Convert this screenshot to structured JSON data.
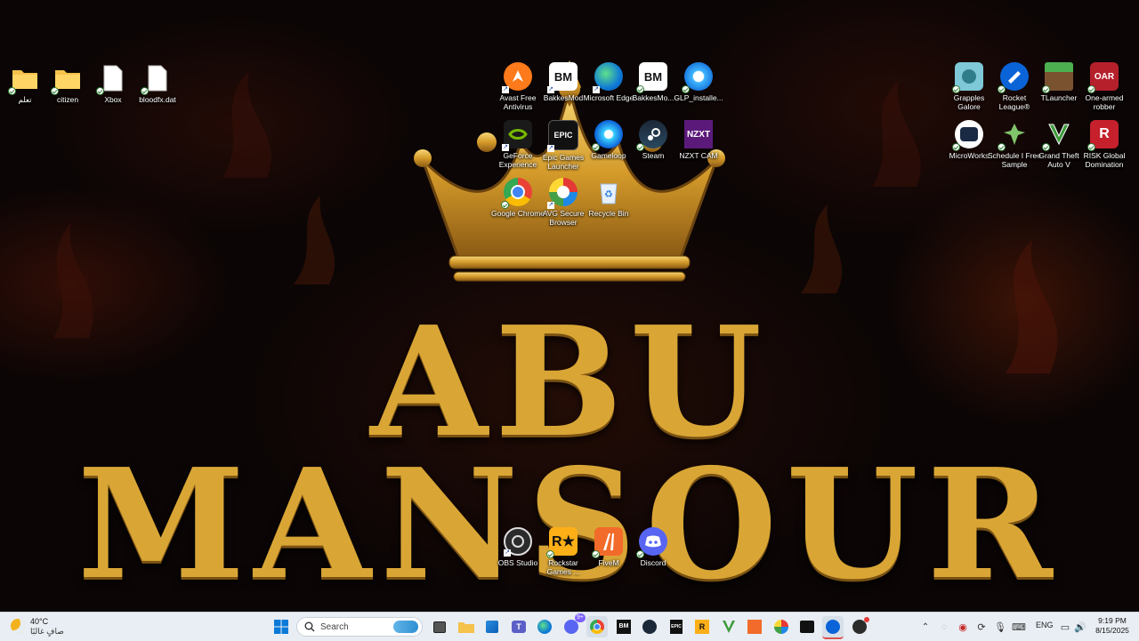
{
  "wallpaper": {
    "line1": "ABU",
    "line2": "MANSOUR"
  },
  "desktop": {
    "left": [
      {
        "label": "تعلم",
        "icon": "folder-icon"
      },
      {
        "label": "citizen",
        "icon": "folder-icon"
      },
      {
        "label": "Xbox",
        "icon": "file-icon"
      },
      {
        "label": "bloodfx.dat",
        "icon": "file-icon"
      }
    ],
    "center": [
      {
        "label": "Avast Free Antivirus",
        "icon": "avast-icon"
      },
      {
        "label": "BakkesMod",
        "icon": "bakkesmod-icon"
      },
      {
        "label": "Microsoft Edge",
        "icon": "edge-icon"
      },
      {
        "label": "BakkesMo...",
        "icon": "bakkesmod-icon"
      },
      {
        "label": "GLP_installe...",
        "icon": "glp-installer-icon"
      },
      {
        "label": "GeForce Experience",
        "icon": "geforce-icon"
      },
      {
        "label": "Epic Games Launcher",
        "icon": "epic-games-icon"
      },
      {
        "label": "Gameloop",
        "icon": "gameloop-icon"
      },
      {
        "label": "Steam",
        "icon": "steam-icon"
      },
      {
        "label": "NZXT CAM",
        "icon": "nzxt-icon"
      },
      {
        "label": "Google Chrome",
        "icon": "chrome-icon"
      },
      {
        "label": "AVG Secure Browser",
        "icon": "avg-browser-icon"
      },
      {
        "label": "Recycle Bin",
        "icon": "recycle-bin-icon"
      }
    ],
    "right": [
      {
        "label": "Grapples Galore",
        "icon": "grapples-icon"
      },
      {
        "label": "Rocket League®",
        "icon": "rocket-league-icon"
      },
      {
        "label": "TLauncher",
        "icon": "tlauncher-icon"
      },
      {
        "label": "One-armed robber",
        "icon": "one-armed-robber-icon"
      },
      {
        "label": "MicroWorks",
        "icon": "microworks-icon"
      },
      {
        "label": "Schedule I Free Sample",
        "icon": "schedule-one-icon"
      },
      {
        "label": "Grand Theft Auto V",
        "icon": "gta-icon"
      },
      {
        "label": "RISK Global Domination",
        "icon": "risk-icon"
      }
    ],
    "bottom": [
      {
        "label": "OBS Studio",
        "icon": "obs-icon"
      },
      {
        "label": "Rockstar Games ...",
        "icon": "rockstar-icon"
      },
      {
        "label": "FiveM",
        "icon": "fivem-icon"
      },
      {
        "label": "Discord",
        "icon": "discord-icon"
      }
    ]
  },
  "taskbar": {
    "weather_temp": "40°C",
    "weather_desc": "صافٍ غالبًا",
    "search_placeholder": "Search",
    "notification_count": "9+",
    "language": "ENG",
    "time": "9:19 PM",
    "date": "8/15/2025"
  },
  "colors": {
    "title_gold": "#d9a636",
    "taskbar_bg": "#e9eef4"
  }
}
